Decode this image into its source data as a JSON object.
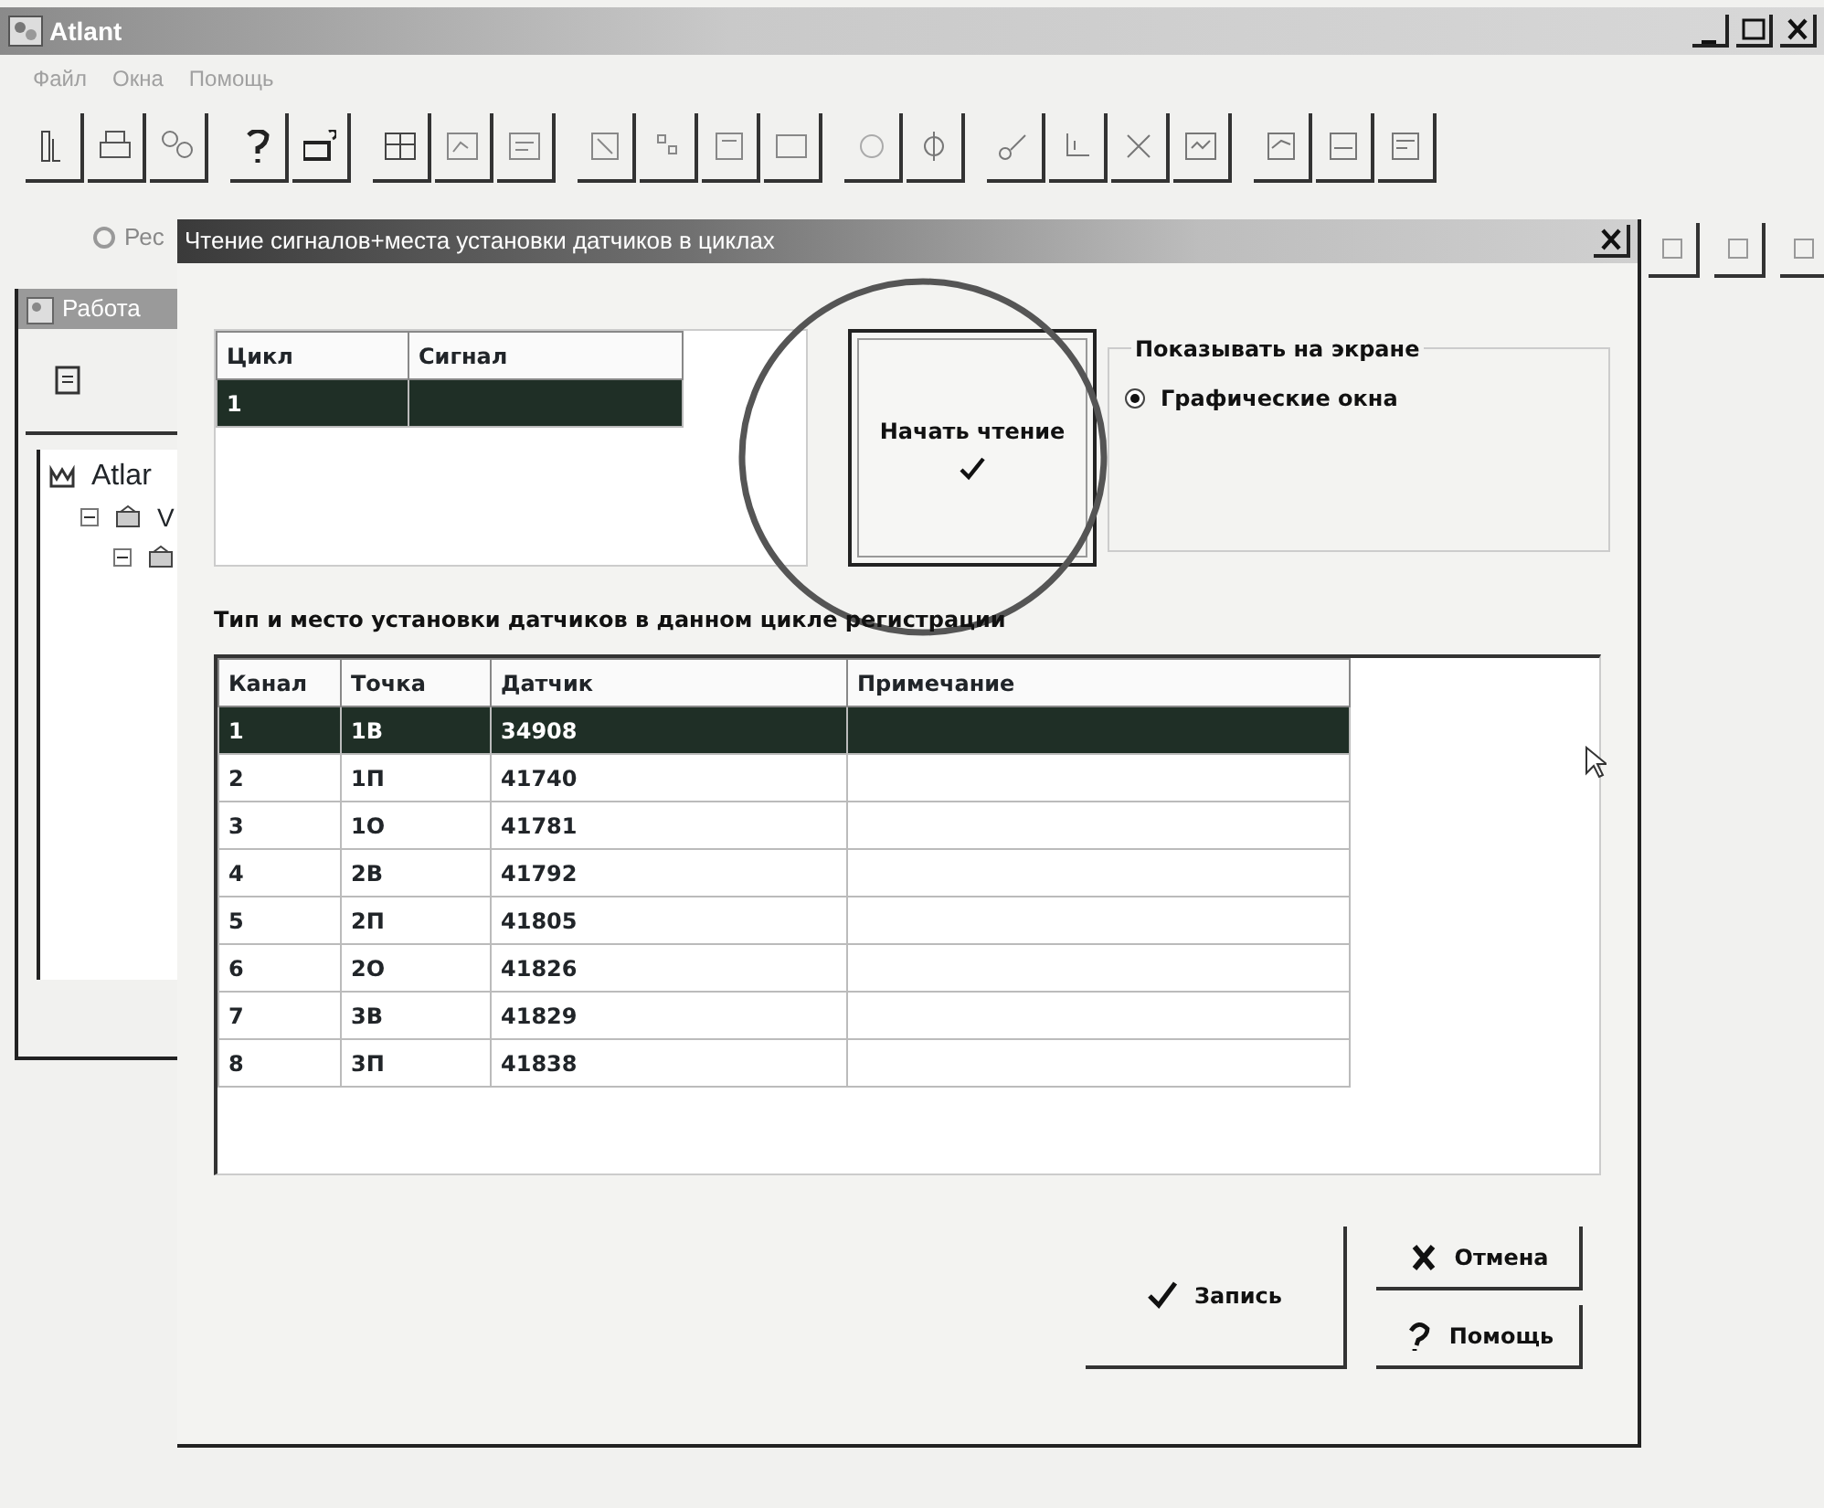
{
  "window": {
    "title": "Atlant"
  },
  "menu": [
    {
      "label": "Файл"
    },
    {
      "label": "Окна"
    },
    {
      "label": "Помощь"
    }
  ],
  "second_toolbar": {
    "label": "Рес"
  },
  "side_panel": {
    "title": "Работа",
    "tree": [
      {
        "label": "Atlar",
        "children": [
          {
            "label": "V",
            "expanded": true,
            "children": [
              {
                "expanded": true
              }
            ]
          }
        ]
      }
    ]
  },
  "dialog": {
    "title": "Чтение сигналов+места установки датчиков в циклах",
    "cycles_table": {
      "columns": [
        "Цикл",
        "Сигнал"
      ],
      "rows": [
        {
          "cycle": "1",
          "selected": true
        }
      ]
    },
    "start_button": {
      "label": "Начать чтение"
    },
    "display_group": {
      "title": "Показывать на экране",
      "options": [
        {
          "label": "Графические окна",
          "selected": true
        }
      ]
    },
    "sensors_title": "Тип и место установки датчиков в данном цикле регистрации",
    "sensors_table": {
      "columns": [
        "Канал",
        "Точка",
        "Датчик",
        "Примечание"
      ],
      "rows": [
        {
          "channel": "1",
          "point": "1В",
          "sensor": "34908",
          "selected": true
        },
        {
          "channel": "2",
          "point": "1П",
          "sensor": "41740",
          "selected": false
        },
        {
          "channel": "3",
          "point": "1О",
          "sensor": "41781",
          "selected": false
        },
        {
          "channel": "4",
          "point": "2В",
          "sensor": "41792",
          "selected": false
        },
        {
          "channel": "5",
          "point": "2П",
          "sensor": "41805",
          "selected": false
        },
        {
          "channel": "6",
          "point": "2О",
          "sensor": "41826",
          "selected": false
        },
        {
          "channel": "7",
          "point": "3В",
          "sensor": "41829",
          "selected": false
        },
        {
          "channel": "8",
          "point": "3П",
          "sensor": "41838",
          "selected": false
        }
      ]
    },
    "buttons": [
      {
        "kind": "save",
        "label": "Запись"
      },
      {
        "kind": "cancel",
        "label": "Отмена"
      },
      {
        "kind": "help",
        "label": "Помощь"
      }
    ]
  }
}
